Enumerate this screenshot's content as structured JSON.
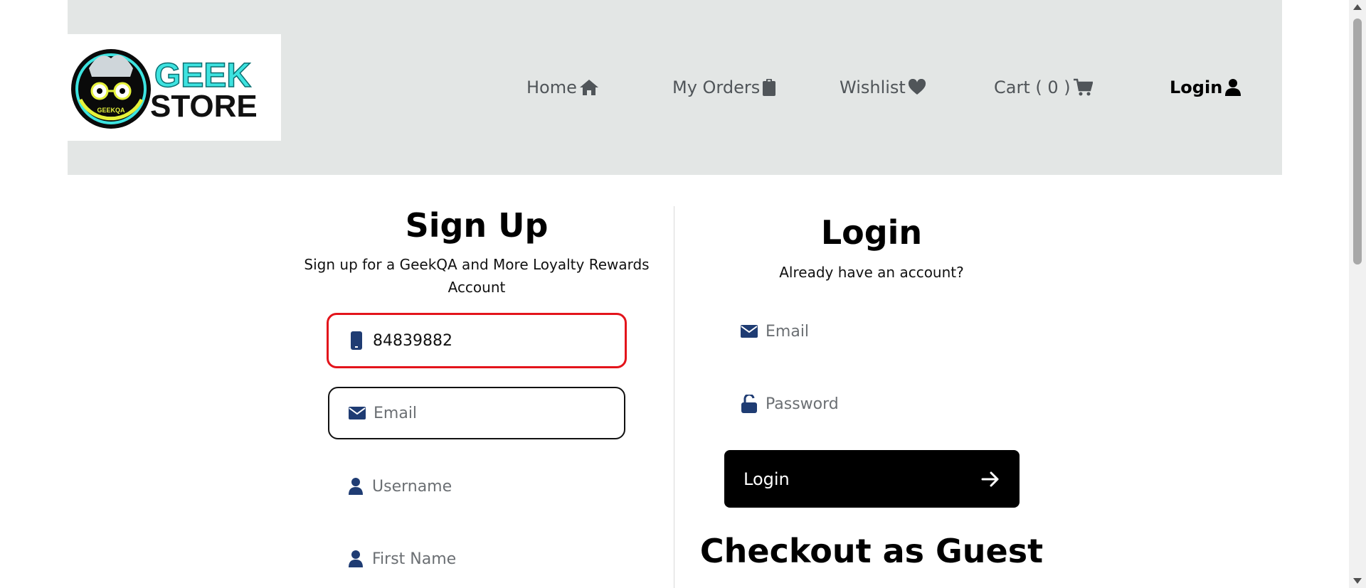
{
  "header": {
    "logo": {
      "top_text": "GEEK",
      "bottom_text": "STORE",
      "badge_text": "GEEKQA"
    },
    "nav": [
      {
        "label": "Home",
        "icon": "home-icon"
      },
      {
        "label": "My Orders",
        "icon": "clipboard-icon"
      },
      {
        "label": "Wishlist",
        "icon": "heart-icon"
      },
      {
        "label": "Cart ( 0 )",
        "icon": "cart-icon"
      },
      {
        "label": "Login",
        "icon": "user-icon"
      }
    ]
  },
  "signup": {
    "title": "Sign Up",
    "subtitle_line1": "Sign up for a GeekQA and More Loyalty Rewards",
    "subtitle_line2": "Account",
    "phone": {
      "value": "84839882",
      "placeholder": ""
    },
    "email": {
      "value": "",
      "placeholder": "Email"
    },
    "username": {
      "value": "",
      "placeholder": "Username"
    },
    "first_name": {
      "value": "",
      "placeholder": "First Name"
    }
  },
  "login": {
    "title": "Login",
    "subtitle": "Already have an account?",
    "email": {
      "value": "",
      "placeholder": "Email"
    },
    "password": {
      "value": "",
      "placeholder": "Password"
    },
    "button_label": "Login"
  },
  "guest": {
    "title": "Checkout as Guest"
  },
  "colors": {
    "header_bg": "#e3e6e5",
    "icon_blue": "#1f3c73",
    "highlight_red": "#e3141b",
    "logo_cyan": "#3de3e0"
  }
}
